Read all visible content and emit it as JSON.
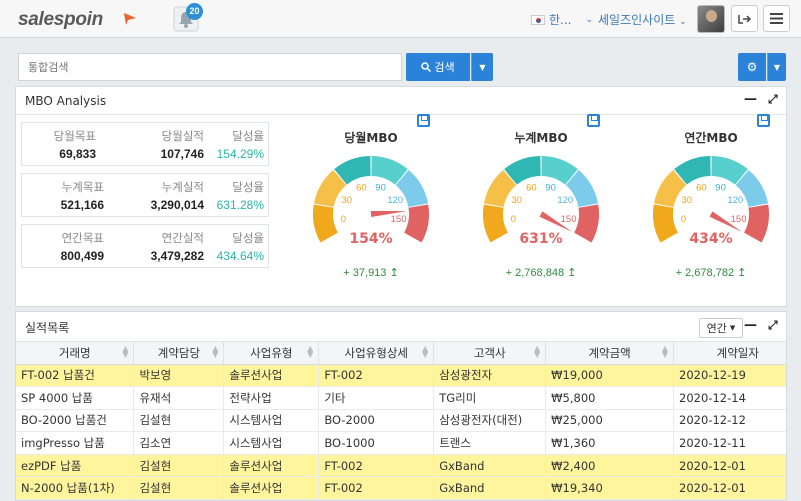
{
  "header": {
    "logo_text": "salespoin",
    "notification_count": "20",
    "language_label": "한...",
    "user_menu_label": "세일즈인사이트",
    "accent": "#2b82d9"
  },
  "search": {
    "placeholder": "통합검색",
    "button_label": "검색"
  },
  "mbo": {
    "title": "MBO Analysis",
    "stats": [
      {
        "target_label": "당월목표",
        "target": "69,833",
        "actual_label": "당월실적",
        "actual": "107,746",
        "rate_label": "달성율",
        "rate": "154.29%"
      },
      {
        "target_label": "누계목표",
        "target": "521,166",
        "actual_label": "누계실적",
        "actual": "3,290,014",
        "rate_label": "달성율",
        "rate": "631.28%"
      },
      {
        "target_label": "연간목표",
        "target": "800,499",
        "actual_label": "연간실적",
        "actual": "3,479,282",
        "rate_label": "달성율",
        "rate": "434.64%"
      }
    ],
    "gauges": [
      {
        "title": "당월MBO",
        "percent": "154%",
        "value": 154,
        "delta": "+ 37,913 ↥"
      },
      {
        "title": "누계MBO",
        "percent": "631%",
        "value": 631,
        "delta": "+ 2,768,848 ↥"
      },
      {
        "title": "연간MBO",
        "percent": "434%",
        "value": 434,
        "delta": "+ 2,678,782 ↥"
      }
    ],
    "gauge_ticks": [
      "0",
      "30",
      "60",
      "90",
      "120",
      "150"
    ]
  },
  "list": {
    "title": "실적목록",
    "period_select": "연간",
    "columns": [
      "거래명",
      "계약담당",
      "사업유형",
      "사업유형상세",
      "고객사",
      "계약금액",
      "계약일자"
    ],
    "rows": [
      {
        "highlight": true,
        "cells": [
          "FT-002 납품건",
          "박보영",
          "솔루션사업",
          "FT-002",
          "삼성광전자",
          "₩19,000",
          "2020-12-19"
        ]
      },
      {
        "highlight": false,
        "cells": [
          "SP 4000 납품",
          "유재석",
          "전략사업",
          "기타",
          "TG리미",
          "₩5,800",
          "2020-12-14"
        ]
      },
      {
        "highlight": false,
        "cells": [
          "BO-2000 납품건",
          "김설현",
          "시스템사업",
          "BO-2000",
          "삼성광전자(대전)",
          "₩25,000",
          "2020-12-12"
        ]
      },
      {
        "highlight": false,
        "cells": [
          "imgPresso 납품",
          "김소연",
          "시스템사업",
          "BO-1000",
          "트랜스",
          "₩1,360",
          "2020-12-11"
        ]
      },
      {
        "highlight": true,
        "cells": [
          "ezPDF 납품",
          "김설현",
          "솔루션사업",
          "FT-002",
          "GxBand",
          "₩2,400",
          "2020-12-01"
        ]
      },
      {
        "highlight": true,
        "cells": [
          "N-2000 납품(1차)",
          "김설현",
          "솔루션사업",
          "FT-002",
          "GxBand",
          "₩19,340",
          "2020-12-01"
        ]
      }
    ]
  }
}
